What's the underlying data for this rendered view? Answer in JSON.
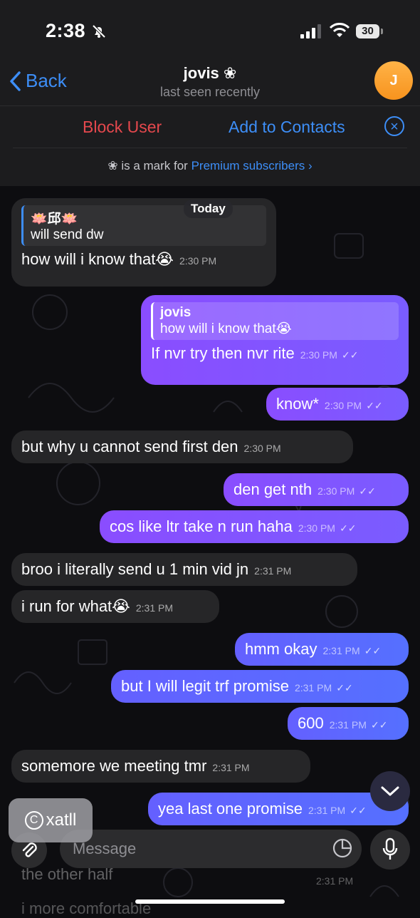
{
  "status_bar": {
    "time": "2:38",
    "battery": "30"
  },
  "header": {
    "back_label": "Back",
    "name": "jovis ❀",
    "status": "last seen recently",
    "avatar_letter": "J"
  },
  "actions": {
    "block_user": "Block User",
    "add_to_contacts": "Add to Contacts",
    "premium_prefix": "❀ is a mark for ",
    "premium_link": "Premium subscribers ›"
  },
  "chat": {
    "date_label": "Today",
    "messages": [
      {
        "dir": "in",
        "reply_name": "🪷邱🪷",
        "reply_text": "will send dw",
        "text": "how will i know that😭",
        "time": "2:30 PM"
      },
      {
        "dir": "out",
        "reply_name": "jovis",
        "reply_text": "how will i know that😭",
        "text": "If nvr try then nvr rite",
        "time": "2:30 PM"
      },
      {
        "dir": "out",
        "text": "know*",
        "time": "2:30 PM"
      },
      {
        "dir": "in",
        "text": "but why u cannot send first den",
        "time": "2:30 PM"
      },
      {
        "dir": "out",
        "text": "den get nth",
        "time": "2:30 PM"
      },
      {
        "dir": "out",
        "text": "cos like ltr take n run haha",
        "time": "2:30 PM"
      },
      {
        "dir": "in",
        "text": "broo i literally send u 1 min vid jn",
        "time": "2:31 PM"
      },
      {
        "dir": "in",
        "text": "i run for what😭",
        "time": "2:31 PM"
      },
      {
        "dir": "out",
        "text": "hmm okay",
        "time": "2:31 PM"
      },
      {
        "dir": "out",
        "text": "but I will legit trf promise",
        "time": "2:31 PM"
      },
      {
        "dir": "out",
        "text": "600",
        "time": "2:31 PM"
      },
      {
        "dir": "in",
        "text": "somemore we meeting tmr",
        "time": "2:31 PM"
      },
      {
        "dir": "out",
        "text": "yea last one promise",
        "time": "2:31 PM"
      }
    ],
    "tick": "✓✓"
  },
  "input": {
    "placeholder": "Message",
    "ghost_line1": "the other half",
    "ghost_time": "2:31 PM",
    "ghost_line2": "i more comfortable"
  },
  "watermark": {
    "text": "xatll",
    "symbol": "C"
  }
}
